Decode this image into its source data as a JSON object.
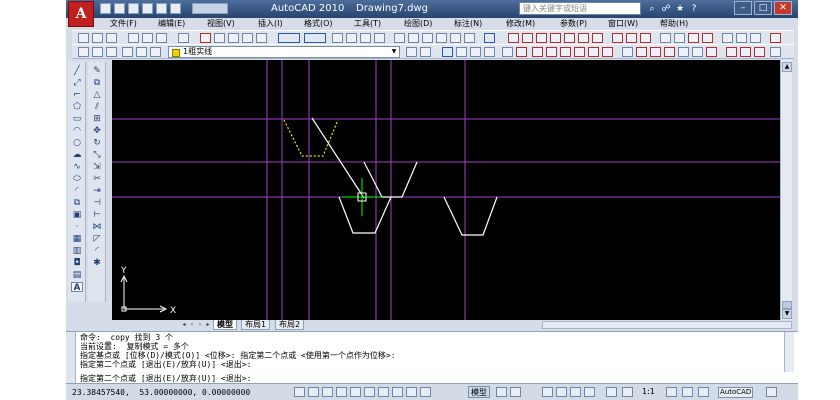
{
  "titlebar": {
    "app_title": "AutoCAD 2010",
    "file_title": "Drawing7.dwg",
    "search_placeholder": "键入关键字或短语",
    "logo_letter": "A"
  },
  "menu": [
    {
      "label": "文件(F)"
    },
    {
      "label": "编辑(E)"
    },
    {
      "label": "视图(V)"
    },
    {
      "label": "插入(I)"
    },
    {
      "label": "格式(O)"
    },
    {
      "label": "工具(T)"
    },
    {
      "label": "绘图(D)"
    },
    {
      "label": "标注(N)"
    },
    {
      "label": "修改(M)"
    },
    {
      "label": "参数(P)"
    },
    {
      "label": "窗口(W)"
    },
    {
      "label": "帮助(H)"
    }
  ],
  "layer": {
    "current": "1粗实线"
  },
  "ucs": {
    "x_label": "X",
    "y_label": "Y"
  },
  "tabs": [
    {
      "label": "模型",
      "active": true
    },
    {
      "label": "布局1",
      "active": false
    },
    {
      "label": "布局2",
      "active": false
    }
  ],
  "command_history": [
    "命令: _copy 找到 3 个",
    "当前设置:  复制模式 = 多个",
    "指定基点或 [位移(D)/模式(O)] <位移>: 指定第二个点或 <使用第一个点作为位移>:",
    "指定第二个点或 [退出(E)/放弃(U)] <退出>:"
  ],
  "command_prompt": "指定第二个点或 [退出(E)/放弃(U)] <退出>:",
  "status": {
    "coordinates": "23.38457540,  53.00000000, 0.00000000",
    "model_label": "模型",
    "annotation_scale": "1:1",
    "workspace": "AutoCAD"
  },
  "colors": {
    "canvas_bg": "#000000",
    "construction_line": "#a040c8",
    "object_line": "#ffffff",
    "selected_line": "#f2e600",
    "crosshair": "#00ff00"
  }
}
